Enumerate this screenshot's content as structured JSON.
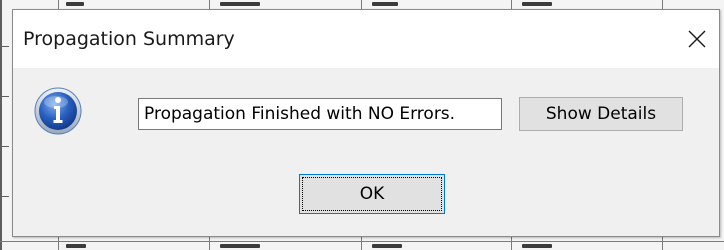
{
  "dialog": {
    "title": "Propagation Summary",
    "close_icon": "close-icon",
    "icon": "info-icon",
    "message": "Propagation Finished with NO Errors.",
    "details_label": "Show Details",
    "ok_label": "OK"
  },
  "colors": {
    "icon_blue": "#2a5fc0",
    "icon_border": "#5a7fb8",
    "focus_border": "#0078d7",
    "button_face": "#e1e1e1",
    "dialog_body": "#f0f0f0"
  }
}
